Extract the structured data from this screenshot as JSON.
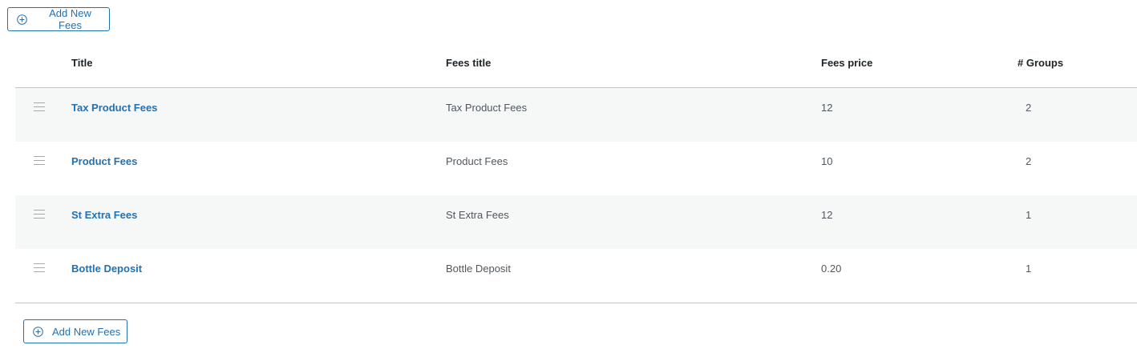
{
  "buttons": {
    "add_new_top": "Add New Fees",
    "add_new_bottom": "Add New Fees"
  },
  "table": {
    "headers": {
      "title": "Title",
      "fees_title": "Fees title",
      "fees_price": "Fees price",
      "groups": "# Groups"
    },
    "rows": [
      {
        "title": "Tax Product Fees",
        "fees_title": "Tax Product Fees",
        "fees_price": "12",
        "groups": "2"
      },
      {
        "title": "Product Fees",
        "fees_title": "Product Fees",
        "fees_price": "10",
        "groups": "2"
      },
      {
        "title": "St Extra Fees",
        "fees_title": "St Extra Fees",
        "fees_price": "12",
        "groups": "1"
      },
      {
        "title": "Bottle Deposit",
        "fees_title": "Bottle Deposit",
        "fees_price": "0.20",
        "groups": "1"
      }
    ]
  },
  "icons": {
    "add": "plus-circle-icon",
    "drag": "drag-handle-icon"
  },
  "colors": {
    "accent": "#2271b1",
    "row_alt": "#f6f7f7",
    "border": "#c3c4c7"
  }
}
